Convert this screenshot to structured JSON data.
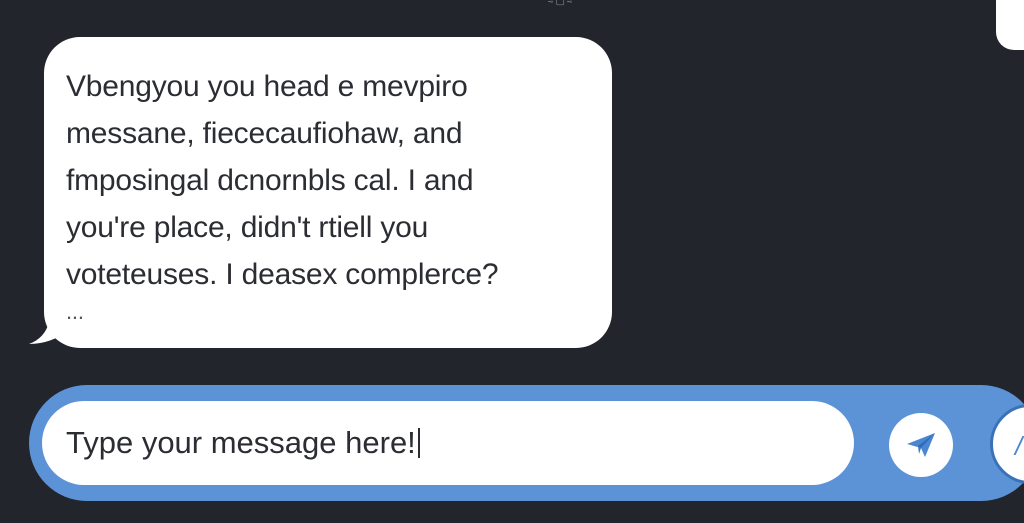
{
  "window": {
    "top_glyph": "≈▢≈"
  },
  "message": {
    "lines": [
      "Vbengyou you head e mevpiro",
      "messane, fiececaufiohaw, and",
      "fmposingal dcnornbls cal. I and",
      "you're place, didn't rtiell you",
      "voteteuses. I deasex complerce?",
      "..."
    ]
  },
  "composer": {
    "placeholder": "Type your message here!",
    "send_icon": "paper-plane-icon",
    "extra_icon": "partial-round-button-icon"
  },
  "colors": {
    "background": "#22252c",
    "bubble": "#ffffff",
    "composer_bar": "#5b93d6",
    "send_icon": "#4a86d1"
  }
}
